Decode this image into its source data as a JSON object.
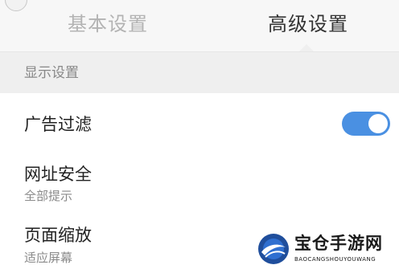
{
  "tabs": {
    "basic_label": "基本设置",
    "advanced_label": "高级设置",
    "active": "advanced"
  },
  "section": {
    "title": "显示设置"
  },
  "settings": {
    "ad_filter": {
      "label": "广告过滤",
      "enabled": true
    },
    "url_security": {
      "label": "网址安全",
      "value": "全部提示"
    },
    "page_zoom": {
      "label": "页面缩放",
      "value": "适应屏幕"
    }
  },
  "watermark": {
    "name": "宝仓手游网",
    "domain": "BAOCANGSHOUYOUWANG"
  },
  "colors": {
    "accent": "#4a90e2",
    "tab_inactive": "#b3b3b3",
    "tab_active": "#333333",
    "section_bg": "#efefef"
  },
  "icons": {
    "back": "back-icon",
    "logo": "logo-icon"
  }
}
